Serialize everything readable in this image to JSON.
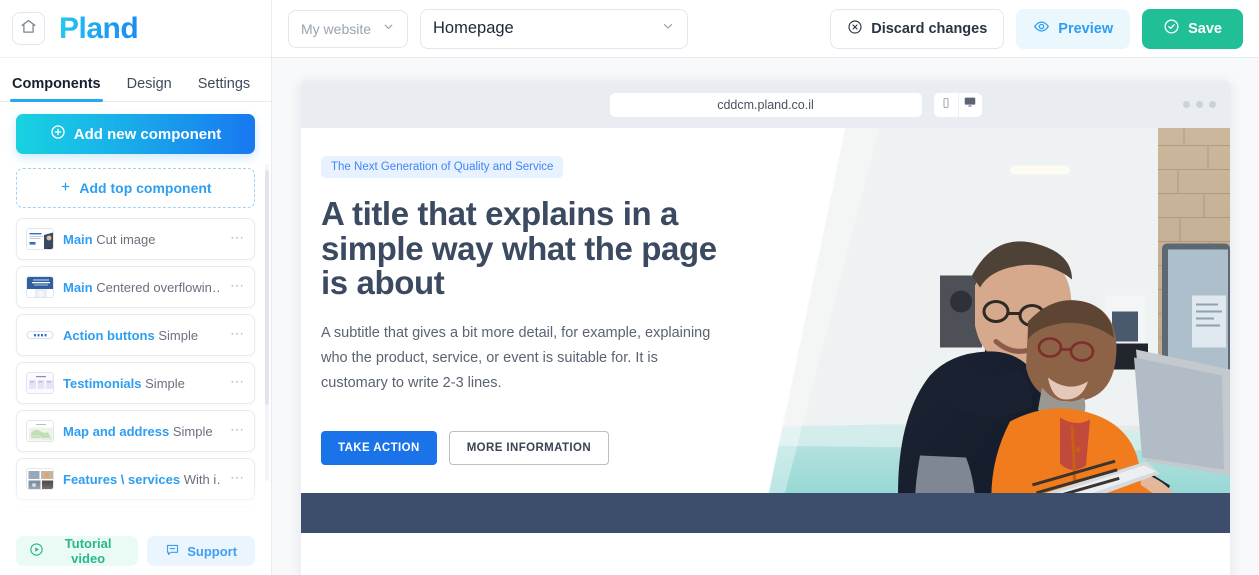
{
  "brand": {
    "name": "Pland",
    "home_icon": "home-icon"
  },
  "tabs": [
    {
      "label": "Components",
      "active": true
    },
    {
      "label": "Design",
      "active": false
    },
    {
      "label": "Settings",
      "active": false
    }
  ],
  "sidebar": {
    "add_new_label": "Add new component",
    "add_new_icon": "plus-circle-icon",
    "add_top_label": "Add top component",
    "add_top_icon": "plus-icon",
    "components": [
      {
        "name": "Main",
        "variant": "Cut image",
        "menu": "⋯"
      },
      {
        "name": "Main",
        "variant": "Centered overflowin…",
        "menu": "⋯"
      },
      {
        "name": "Action buttons",
        "variant": "Simple",
        "menu": "⋯"
      },
      {
        "name": "Testimonials",
        "variant": "Simple",
        "menu": "⋯"
      },
      {
        "name": "Map and address",
        "variant": "Simple",
        "menu": "⋯"
      },
      {
        "name": "Features \\ services",
        "variant": "With i…",
        "menu": "⋯"
      }
    ],
    "footer": {
      "tutorial_label": "Tutorial video",
      "tutorial_icon": "play-circle-icon",
      "support_label": "Support",
      "support_icon": "chat-bubble-icon"
    }
  },
  "topbar": {
    "site_select_value": "My website",
    "page_select_value": "Homepage",
    "chevron_icon": "chevron-down-icon",
    "discard_label": "Discard changes",
    "discard_icon": "close-circle-icon",
    "preview_label": "Preview",
    "preview_icon": "eye-icon",
    "save_label": "Save",
    "save_icon": "check-circle-icon"
  },
  "preview": {
    "url": "cddcm.pland.co.il",
    "device_mobile_icon": "mobile-icon",
    "device_desktop_icon": "desktop-icon",
    "window_dots": "window-dots"
  },
  "hero": {
    "badge": "The Next Generation of Quality and Service",
    "title": "A title that explains in a simple way what the page is about",
    "subtitle": "A subtitle that gives a bit more detail, for example, explaining who the product, service, or event is suitable for. It is customary to write 2-3 lines.",
    "cta_primary": "TAKE ACTION",
    "cta_secondary": "MORE INFORMATION",
    "image_alt": "two men looking at a laptop on a glass counter"
  },
  "colors": {
    "brand_cyan": "#23c9f0",
    "brand_blue": "#1878f0",
    "accent_blue": "#2e9ef0",
    "save_green": "#21bf95",
    "hero_title": "#3b4a60",
    "hero_cta": "#1a73e8",
    "footer_bar": "#3c4e6b"
  }
}
